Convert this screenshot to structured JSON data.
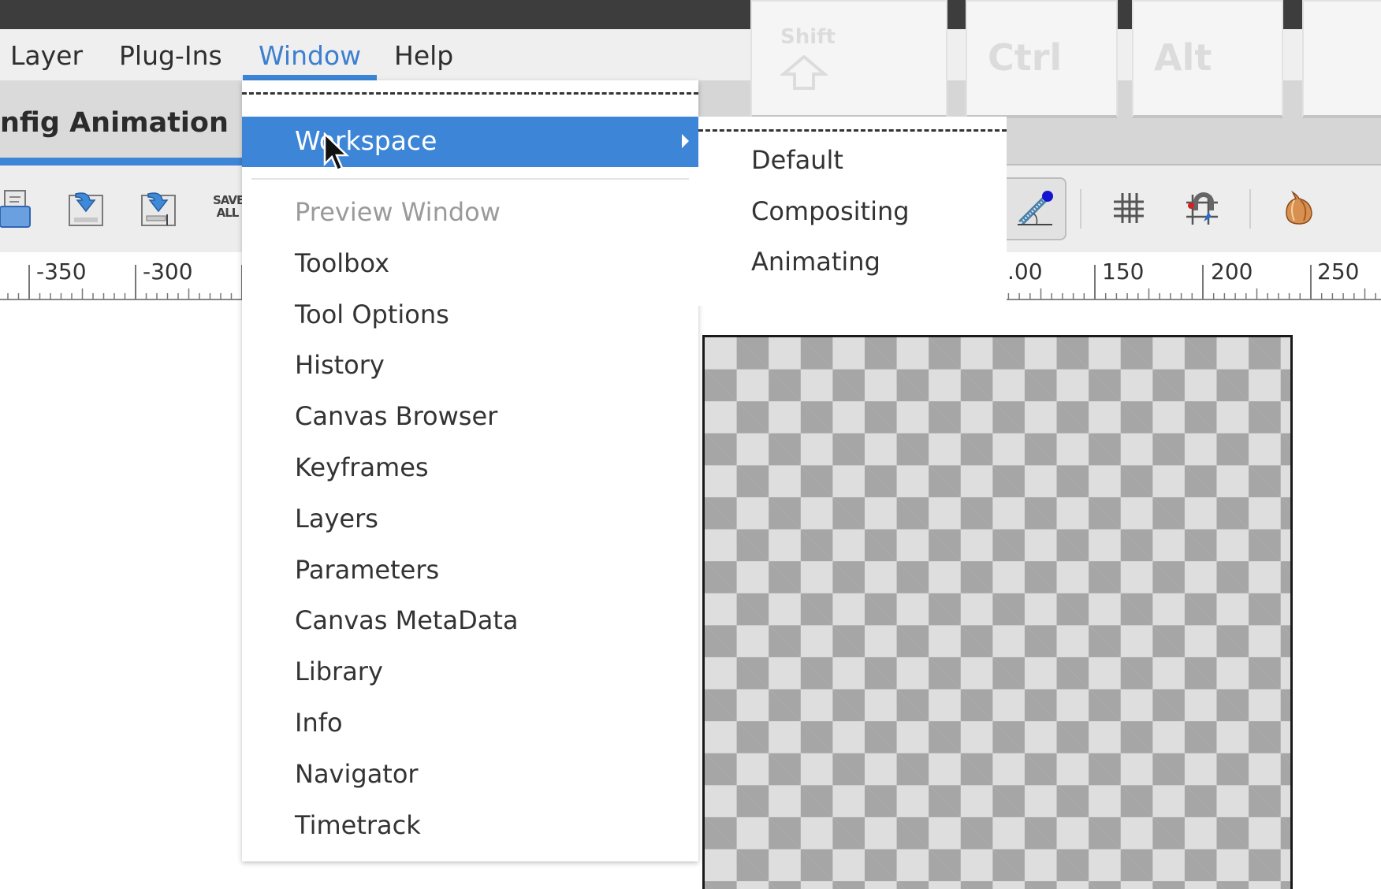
{
  "menubar": {
    "items": [
      {
        "label": "Layer",
        "active": false
      },
      {
        "label": "Plug-Ins",
        "active": false
      },
      {
        "label": "Window",
        "active": true
      },
      {
        "label": "Help",
        "active": false
      }
    ]
  },
  "tab": {
    "label": "nfig Animation"
  },
  "keyboard_overlay": {
    "keys": [
      {
        "label": "Shift",
        "icon": "shift-arrow-icon"
      },
      {
        "label": "Ctrl"
      },
      {
        "label": "Alt"
      },
      {
        "label": ""
      }
    ]
  },
  "toolbar": {
    "left_icons": [
      "open-file-icon",
      "save-icon",
      "save-as-icon",
      "save-all-icon"
    ],
    "save_all_label": "SAVE ALL",
    "right_icons": [
      "skeleton-tool-icon",
      "show-grid-icon",
      "snap-grid-icon",
      "onion-skin-icon"
    ]
  },
  "ruler": {
    "left_labels": [
      "-350",
      "-300"
    ],
    "right_labels": [
      ".00",
      "150",
      "200",
      "250"
    ]
  },
  "window_menu": {
    "highlighted": {
      "label": "Workspace",
      "has_submenu": true
    },
    "items": [
      {
        "label": "Preview Window",
        "disabled": true
      },
      {
        "label": "Toolbox",
        "disabled": false
      },
      {
        "label": "Tool Options",
        "disabled": false
      },
      {
        "label": "History",
        "disabled": false
      },
      {
        "label": "Canvas Browser",
        "disabled": false
      },
      {
        "label": "Keyframes",
        "disabled": false
      },
      {
        "label": "Layers",
        "disabled": false
      },
      {
        "label": "Parameters",
        "disabled": false
      },
      {
        "label": "Canvas MetaData",
        "disabled": false
      },
      {
        "label": "Library",
        "disabled": false
      },
      {
        "label": "Info",
        "disabled": false
      },
      {
        "label": "Navigator",
        "disabled": false
      },
      {
        "label": "Timetrack",
        "disabled": false
      }
    ]
  },
  "workspace_submenu": {
    "items": [
      {
        "label": "Default"
      },
      {
        "label": "Compositing"
      },
      {
        "label": "Animating"
      }
    ]
  },
  "colors": {
    "accent": "#3d85d6",
    "checker_dark": "#a6a6a6",
    "checker_light": "#dedede"
  }
}
